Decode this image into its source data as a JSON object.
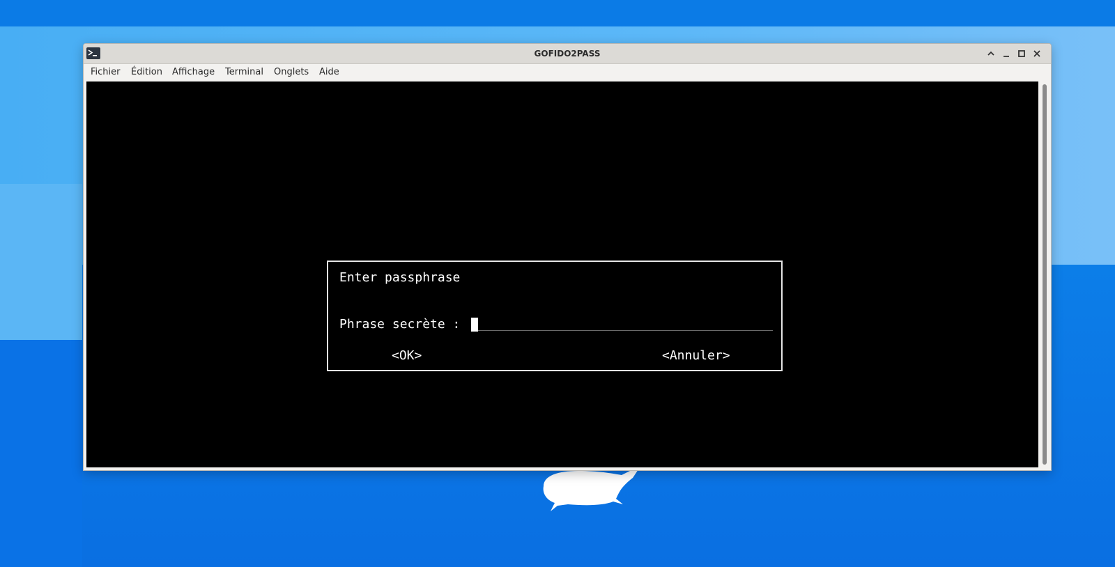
{
  "window": {
    "title": "GOFIDO2PASS"
  },
  "menu": {
    "items": [
      "Fichier",
      "Édition",
      "Affichage",
      "Terminal",
      "Onglets",
      "Aide"
    ]
  },
  "dialog": {
    "title": "Enter passphrase",
    "field_label": "Phrase secrète :",
    "field_value": "",
    "ok_label": "<OK>",
    "cancel_label": "<Annuler>"
  },
  "colors": {
    "desktop": "#0a72e6",
    "terminal_bg": "#000000",
    "terminal_fg": "#ffffff",
    "titlebar": "#dcdad6"
  },
  "icons": {
    "app": "terminal-icon",
    "titlebar_buttons": [
      "shade-icon",
      "minimize-icon",
      "maximize-icon",
      "close-icon"
    ],
    "desktop": "xfce-mouse-logo"
  }
}
